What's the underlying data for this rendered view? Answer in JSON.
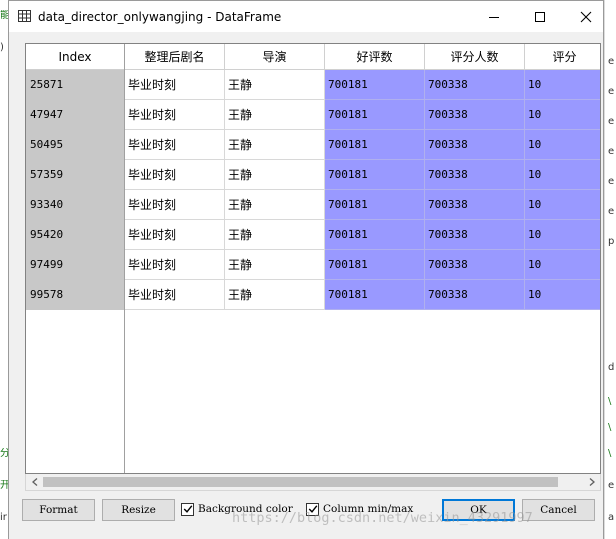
{
  "window": {
    "title": "data_director_onlywangjing - DataFrame"
  },
  "table": {
    "index_header": "Index",
    "columns": [
      "整理后剧名",
      "导演",
      "好评数",
      "评分人数",
      "评分"
    ],
    "rows": [
      {
        "index": "25871",
        "cells": [
          "毕业时刻",
          "王静",
          "700181",
          "700338",
          "10"
        ]
      },
      {
        "index": "47947",
        "cells": [
          "毕业时刻",
          "王静",
          "700181",
          "700338",
          "10"
        ]
      },
      {
        "index": "50495",
        "cells": [
          "毕业时刻",
          "王静",
          "700181",
          "700338",
          "10"
        ]
      },
      {
        "index": "57359",
        "cells": [
          "毕业时刻",
          "王静",
          "700181",
          "700338",
          "10"
        ]
      },
      {
        "index": "93340",
        "cells": [
          "毕业时刻",
          "王静",
          "700181",
          "700338",
          "10"
        ]
      },
      {
        "index": "95420",
        "cells": [
          "毕业时刻",
          "王静",
          "700181",
          "700338",
          "10"
        ]
      },
      {
        "index": "97499",
        "cells": [
          "毕业时刻",
          "王静",
          "700181",
          "700338",
          "10"
        ]
      },
      {
        "index": "99578",
        "cells": [
          "毕业时刻",
          "王静",
          "700181",
          "700338",
          "10"
        ]
      }
    ]
  },
  "buttons": {
    "format": "Format",
    "resize": "Resize",
    "ok": "OK",
    "cancel": "Cancel"
  },
  "checkboxes": {
    "background_color": {
      "label": "Background color",
      "checked": true
    },
    "column_minmax": {
      "label": "Column min/max",
      "checked": true
    }
  },
  "watermark": "https://blog.csdn.net/weixin_43291997",
  "colors": {
    "numeric_cell_bg": "#9999ff",
    "index_cell_bg": "#c8c8c8",
    "ok_border": "#0078d7"
  },
  "background_editor": {
    "left_marks": [
      "能",
      ")",
      "分",
      "开",
      "ir"
    ],
    "right_marks": [
      "e",
      "e",
      "e",
      "e",
      "e",
      "e",
      "p",
      "",
      "d",
      "\\",
      "\\",
      "\\",
      "e",
      "a"
    ]
  }
}
